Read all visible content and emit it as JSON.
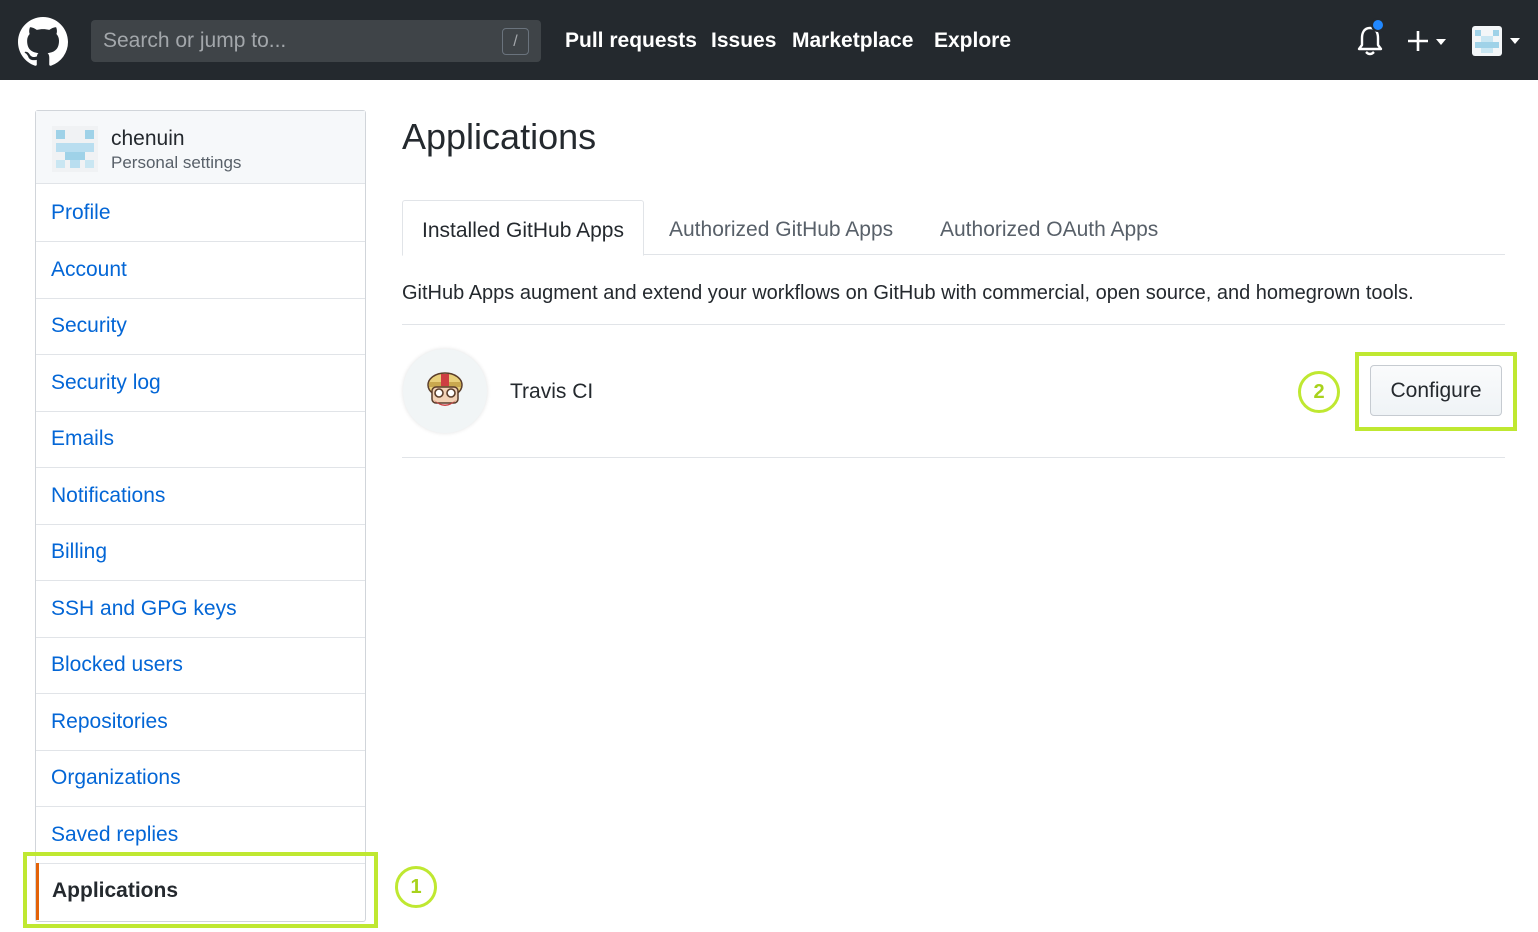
{
  "header": {
    "search_placeholder": "Search or jump to...",
    "search_shortcut": "/",
    "nav": [
      "Pull requests",
      "Issues",
      "Marketplace",
      "Explore"
    ],
    "icons": [
      "github-logo-icon",
      "bell-icon",
      "plus-icon",
      "caret-down-icon",
      "avatar"
    ]
  },
  "sidebar": {
    "username": "chenuin",
    "subtitle": "Personal settings",
    "items": [
      {
        "label": "Profile"
      },
      {
        "label": "Account"
      },
      {
        "label": "Security"
      },
      {
        "label": "Security log"
      },
      {
        "label": "Emails"
      },
      {
        "label": "Notifications"
      },
      {
        "label": "Billing"
      },
      {
        "label": "SSH and GPG keys"
      },
      {
        "label": "Blocked users"
      },
      {
        "label": "Repositories"
      },
      {
        "label": "Organizations"
      },
      {
        "label": "Saved replies"
      },
      {
        "label": "Applications",
        "selected": true
      }
    ]
  },
  "main": {
    "title": "Applications",
    "tabs": [
      {
        "label": "Installed GitHub Apps",
        "active": true
      },
      {
        "label": "Authorized GitHub Apps"
      },
      {
        "label": "Authorized OAuth Apps"
      }
    ],
    "description": "GitHub Apps augment and extend your workflows on GitHub with commercial, open source, and homegrown tools.",
    "apps": [
      {
        "name": "Travis CI",
        "action": "Configure"
      }
    ]
  },
  "annotations": {
    "step1": "1",
    "step2": "2",
    "highlight_color": "#bfe831"
  },
  "colors": {
    "header_bg": "#24292e",
    "link": "#0366d6",
    "selected_border": "#e36209",
    "notification_dot": "#2188ff"
  }
}
